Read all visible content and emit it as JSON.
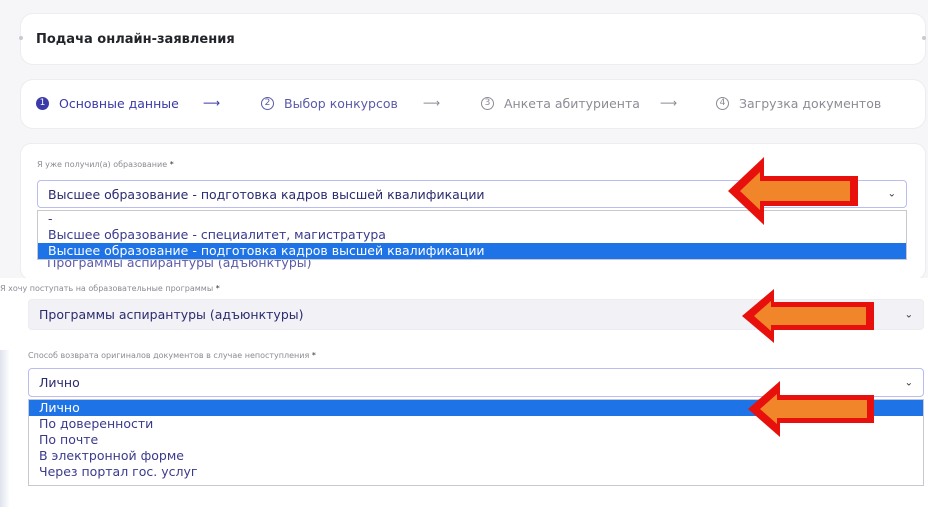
{
  "header": {
    "title": "Подача онлайн-заявления"
  },
  "steps": [
    {
      "num": "1",
      "label": "Основные данные"
    },
    {
      "num": "2",
      "label": "Выбор конкурсов"
    },
    {
      "num": "3",
      "label": "Анкета абитуриента"
    },
    {
      "num": "4",
      "label": "Загрузка документов"
    }
  ],
  "step_arrow": "⟶",
  "form": {
    "education": {
      "label": "Я уже получил(а) образование",
      "required": "*",
      "value": "Высшее образование - подготовка кадров высшей квалификации",
      "options": [
        "-",
        "Высшее образование - специалитет, магистратура",
        "Высшее образование - подготовка кадров высшей квалификации"
      ],
      "behind_text": "Программы аспирантуры (адъюнктуры)"
    },
    "programs": {
      "label": "Я хочу поступать на образовательные программы",
      "required": "*",
      "value": "Программы аспирантуры (адъюнктуры)"
    },
    "return_method": {
      "label": "Способ возврата оригиналов документов в случае непоступления",
      "required": "*",
      "value": "Лично",
      "options": [
        "Лично",
        "По доверенности",
        "По почте",
        "В электронной форме",
        "Через портал гос. услуг"
      ]
    }
  },
  "colors": {
    "accent": "#3a3aa8",
    "selected_option": "#1e74e6",
    "annotation_arrow": "#e8100c",
    "annotation_fill": "#f0852a"
  }
}
